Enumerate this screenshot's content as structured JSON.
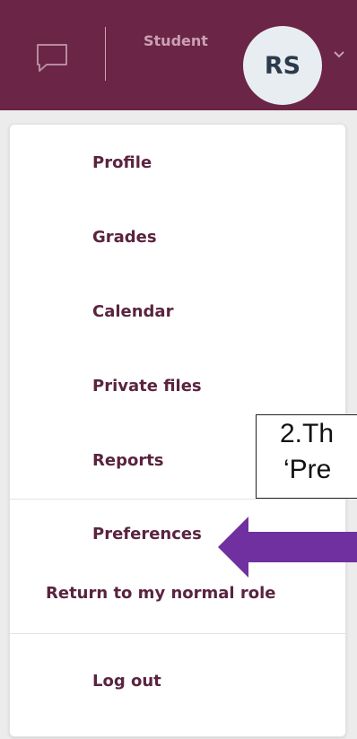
{
  "header": {
    "role_label": "Student",
    "avatar_initials": "RS",
    "icons": {
      "messages": "chat-bubble-icon",
      "user_menu": "chevron-down-icon"
    }
  },
  "menu": {
    "items": [
      {
        "label": "Profile"
      },
      {
        "label": "Grades"
      },
      {
        "label": "Calendar"
      },
      {
        "label": "Private files"
      },
      {
        "label": "Reports"
      },
      {
        "label": "Preferences"
      },
      {
        "label": "Return to my normal role"
      },
      {
        "label": "Log out"
      }
    ]
  },
  "annotation": {
    "line1": "2.Th",
    "line2": "‘Pre",
    "arrow_color": "#7030a0"
  },
  "colors": {
    "header_bg": "#6b2546",
    "menu_text": "#5a2440"
  }
}
